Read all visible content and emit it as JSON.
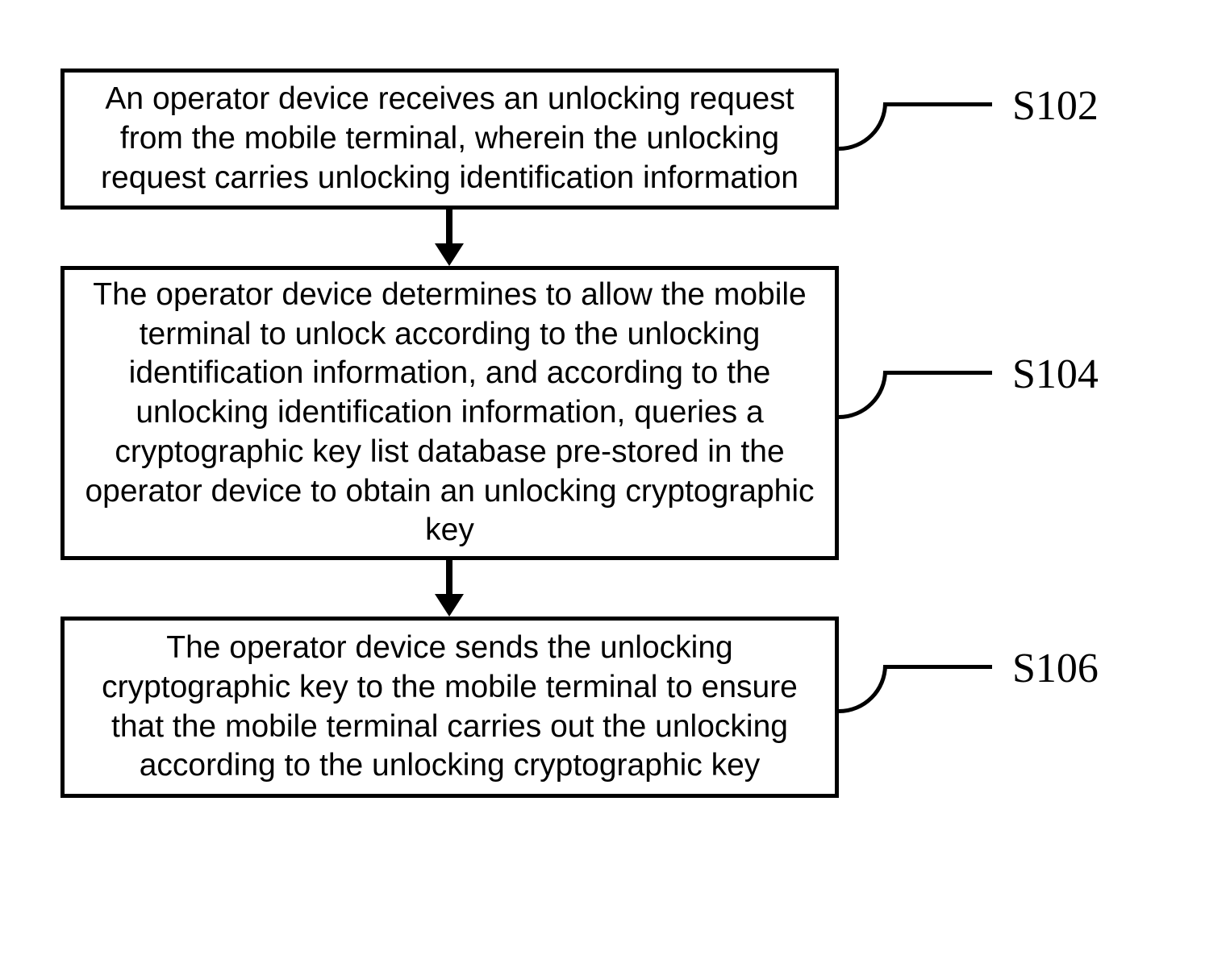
{
  "steps": [
    {
      "id": "S102",
      "text": "An operator device receives an unlocking request from the mobile terminal, wherein the unlocking request carries unlocking identification information"
    },
    {
      "id": "S104",
      "text": "The operator device determines to allow the mobile terminal to unlock according to the unlocking identification information, and according to the unlocking identification information, queries a cryptographic key list database pre-stored in the operator device to obtain an unlocking cryptographic key"
    },
    {
      "id": "S106",
      "text": "The operator device sends the unlocking cryptographic key to the mobile terminal to ensure that the mobile terminal carries out the unlocking according to the unlocking cryptographic key"
    }
  ]
}
